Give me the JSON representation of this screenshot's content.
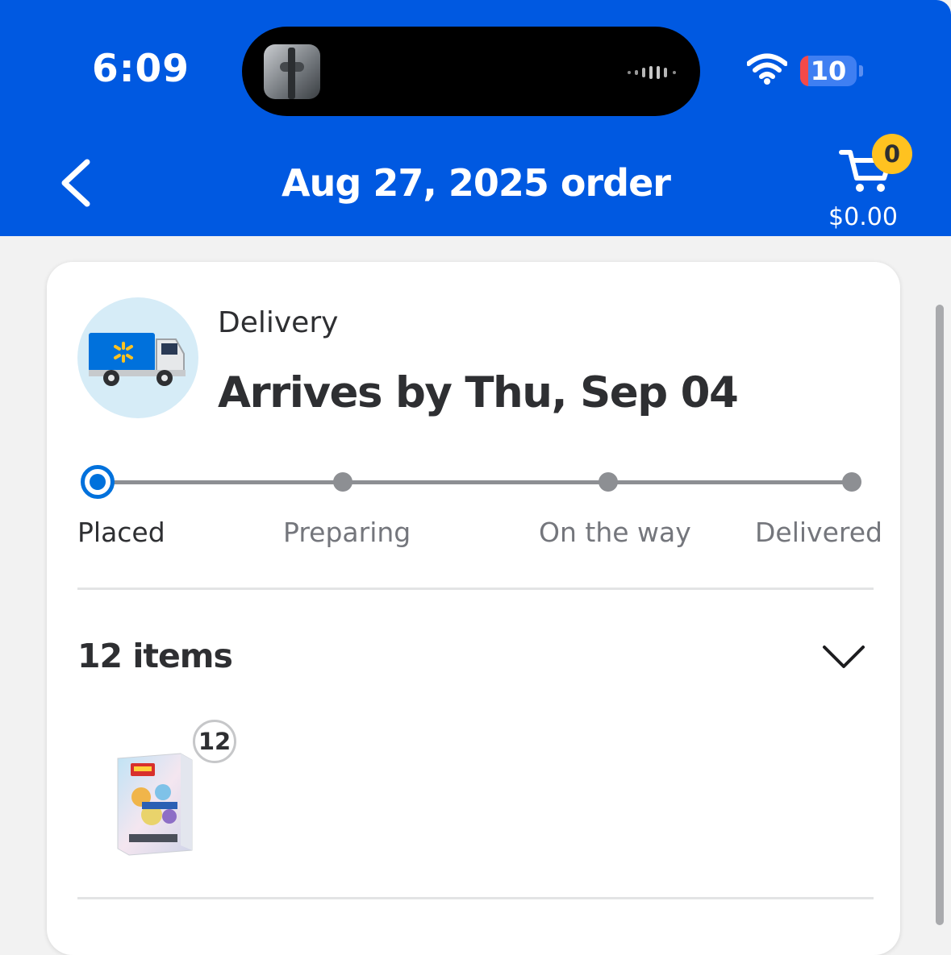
{
  "status_bar": {
    "time": "6:09",
    "battery_level": "10",
    "icons": [
      "wifi-icon",
      "battery-icon"
    ]
  },
  "header": {
    "title": "Aug 27, 2025 order",
    "back_icon": "chevron-left-icon",
    "cart": {
      "count": "0",
      "total": "$0.00",
      "icon": "cart-icon"
    }
  },
  "order": {
    "method": "Delivery",
    "arrival": "Arrives by Thu, Sep 04",
    "tracking_steps": [
      {
        "label": "Placed",
        "status": "current"
      },
      {
        "label": "Preparing",
        "status": "pending"
      },
      {
        "label": "On the way",
        "status": "pending"
      },
      {
        "label": "Delivered",
        "status": "pending"
      }
    ],
    "items_title": "12 items",
    "items": [
      {
        "image": "product-thumbnail",
        "quantity": "12"
      }
    ]
  },
  "colors": {
    "brand_blue": "#0059e1",
    "progress_blue": "#0071dc",
    "cart_badge": "#ffc220",
    "truck_bg": "#d6ecf7"
  }
}
